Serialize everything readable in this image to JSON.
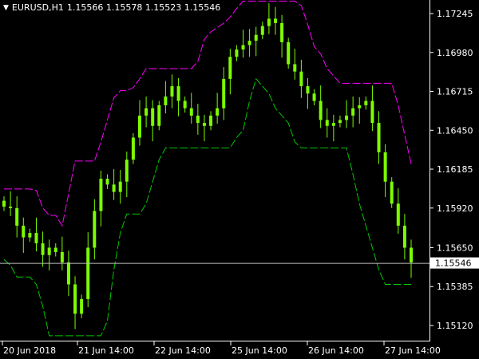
{
  "header": {
    "symbol_timeframe": "EURUSD,H1",
    "ohlc": "1.15566 1.15578 1.15523 1.15546",
    "arrow_icon": "triangle-down-icon"
  },
  "colors": {
    "background": "#000000",
    "candles": "#7CFC00",
    "upper_band": "#ff00ff",
    "lower_band": "#00c800",
    "axis": "#ffffff",
    "price_line": "#c0c0c0"
  },
  "axis": {
    "price_ticks": [
      "1.17245",
      "1.16980",
      "1.16715",
      "1.16450",
      "1.16185",
      "1.15920",
      "1.15650",
      "1.15385",
      "1.15120"
    ],
    "current_price": "1.15546",
    "time_ticks": [
      "20 Jun 2018",
      "21 Jun 14:00",
      "22 Jun 14:00",
      "25 Jun 14:00",
      "26 Jun 14:00",
      "27 Jun 14:00"
    ]
  },
  "chart_data": {
    "type": "line",
    "title": "EURUSD,H1 1.15566 1.15578 1.15523 1.15546",
    "xlabel": "",
    "ylabel": "",
    "ylim": [
      1.1502,
      1.1742
    ],
    "x": [
      "20 Jun 2018",
      "21 Jun 14:00",
      "22 Jun 14:00",
      "25 Jun 14:00",
      "26 Jun 14:00",
      "27 Jun 14:00"
    ],
    "series": [
      {
        "values": [
          1.1593,
          1.1592,
          1.158,
          1.1572,
          1.1575,
          1.1568,
          1.156,
          1.1565,
          1.1562,
          1.1555,
          1.154,
          1.152,
          1.153,
          1.1565,
          1.159,
          1.1612,
          1.1608,
          1.1603,
          1.161,
          1.1625,
          1.164,
          1.1655,
          1.166,
          1.1648,
          1.1662,
          1.1668,
          1.1675,
          1.1665,
          1.166,
          1.1655,
          1.165,
          1.1648,
          1.1655,
          1.166,
          1.168,
          1.1695,
          1.17,
          1.1703,
          1.1706,
          1.171,
          1.1716,
          1.1721,
          1.1718,
          1.1705,
          1.169,
          1.1685,
          1.1675,
          1.167,
          1.1665,
          1.1652,
          1.1648,
          1.165,
          1.1652,
          1.1655,
          1.166,
          1.1662,
          1.1665,
          1.165,
          1.163,
          1.161,
          1.1595,
          1.158,
          1.1565,
          1.1555
        ]
      }
    ]
  }
}
